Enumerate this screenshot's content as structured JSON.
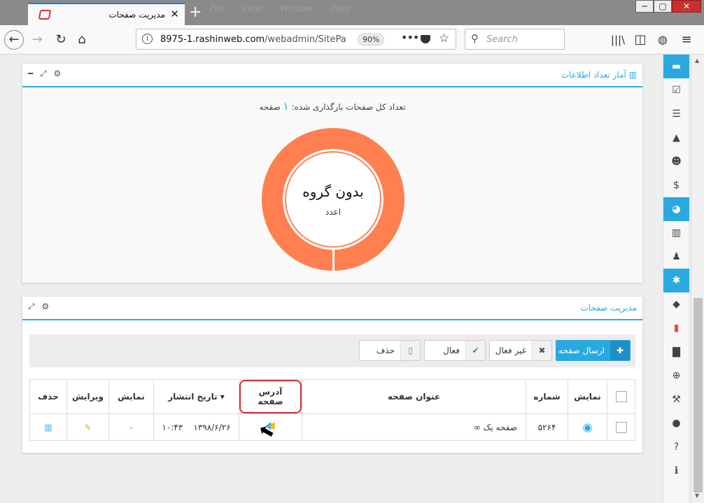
{
  "browser": {
    "tab_title": "مدیریت صفحات",
    "tab_close": "✕",
    "new_tab": "+",
    "bg_menu": [
      "File",
      "View",
      "Window",
      "Help"
    ],
    "url_host": "8975-1.rashinweb.com",
    "url_path": "/webadmin/SitePa",
    "zoom": "90%",
    "search_placeholder": "Search"
  },
  "sidebar_icons": [
    "folder-open-icon",
    "check-square-icon",
    "list-icon",
    "road-icon",
    "users-icon",
    "dollar-icon",
    "pie-chart-icon",
    "bar-chart-icon",
    "sitemap-icon",
    "gear-icon",
    "tags-icon",
    "office-icon",
    "file-icon",
    "zoom-icon",
    "wrench-icon",
    "globe-icon",
    "question-icon",
    "info-icon"
  ],
  "stats_panel": {
    "title": "آمار تعداد اطلاعات",
    "summary_text": "تعداد کل صفحات بارگذاری شده:",
    "count": "۱",
    "unit": "صفحه",
    "donut_label": "بدون گروه",
    "donut_sub": "اعدد",
    "donut_color": "#ff7f50"
  },
  "pages_panel": {
    "title": "مدیریت صفحات",
    "buttons": {
      "send": "ارسال صفحه",
      "inactive": "غیر فعال",
      "active": "فعال",
      "delete": "حذف"
    },
    "columns": {
      "show": "نمایش",
      "number": "شماره",
      "title": "عنوان صفحه",
      "address": "آدرس صفحه",
      "publish_date": "تاریخ انتشار",
      "display": "نمایش",
      "edit": "ویرایش",
      "delete": "حذف"
    },
    "rows": [
      {
        "number": "۵۲۶۴",
        "title": "صفحه یک",
        "date": "۱۳۹۸/۶/۲۶",
        "time": "۱۰:۴۳",
        "views": "۰"
      }
    ]
  },
  "colors": {
    "accent": "#29a9e0",
    "highlight": "#d32f2f"
  }
}
